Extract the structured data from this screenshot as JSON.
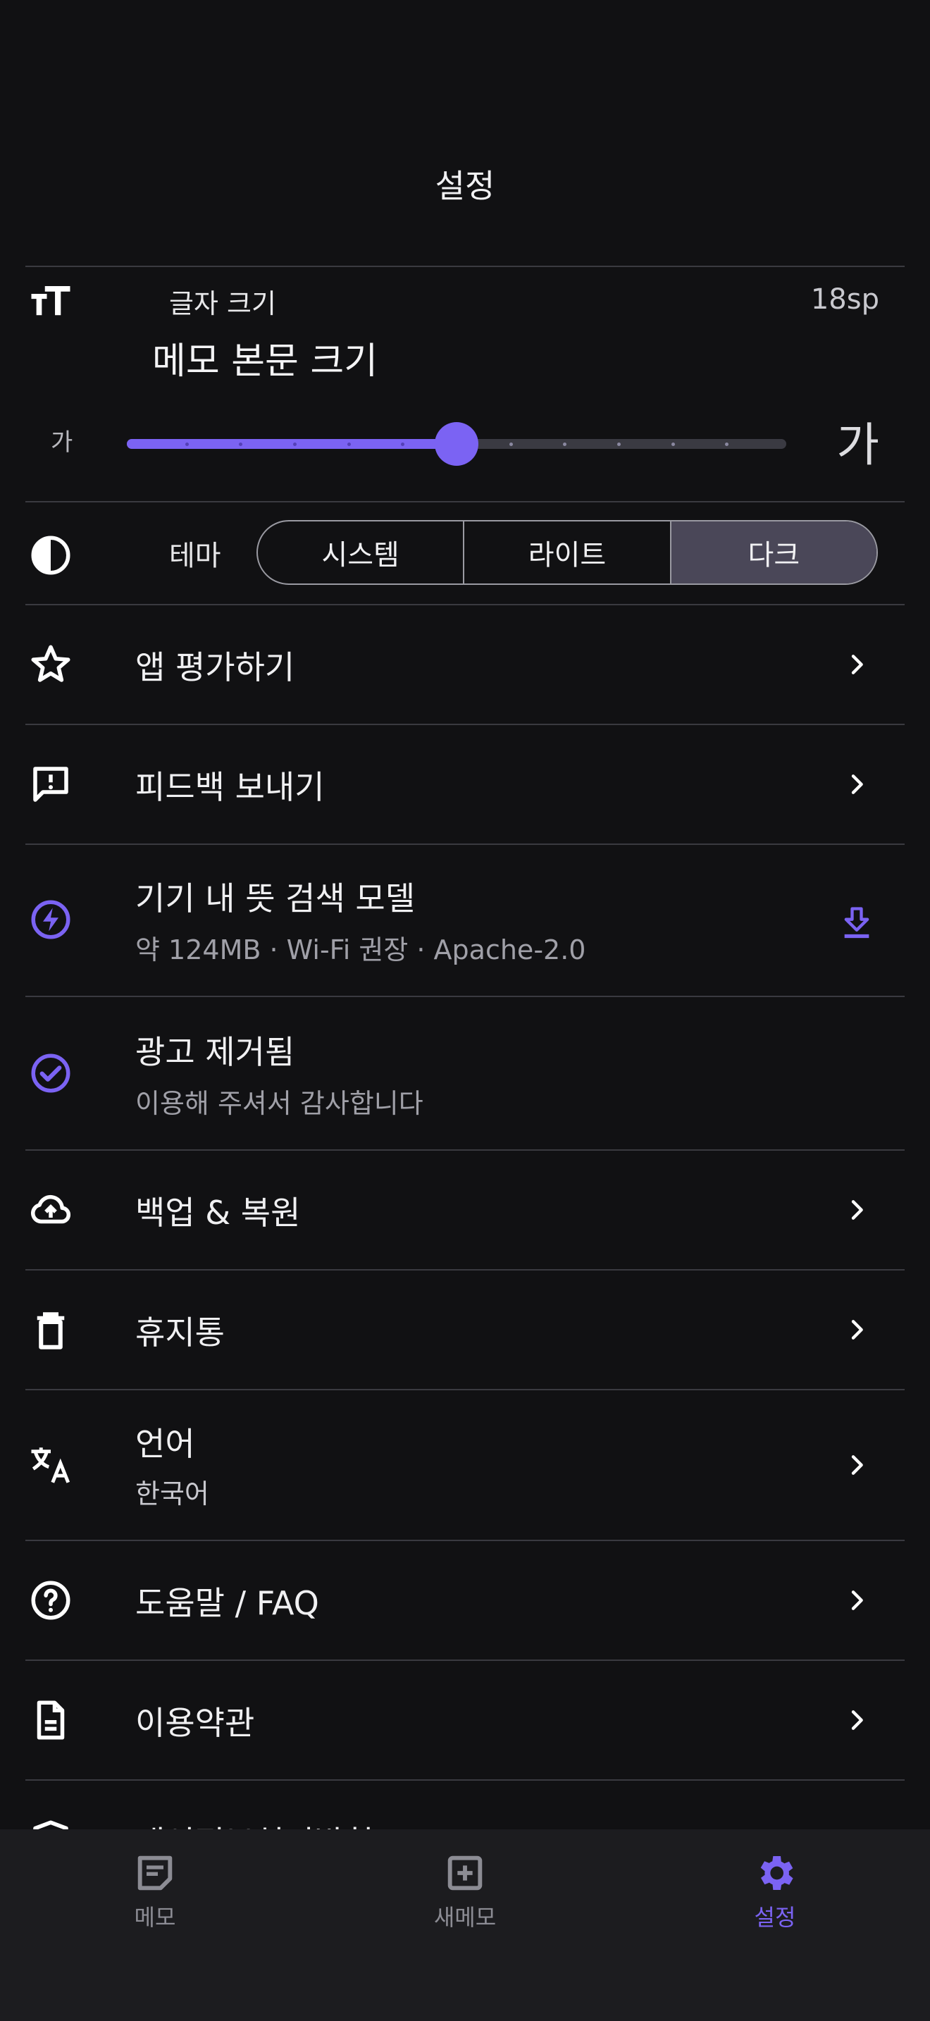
{
  "header": {
    "title": "설정"
  },
  "font_size": {
    "label": "글자 크기",
    "value": "18sp",
    "title": "메모 본문 크기",
    "small_glyph": "가",
    "large_glyph": "가",
    "steps": 12,
    "current_step": 6
  },
  "theme": {
    "label": "테마",
    "options": [
      "시스템",
      "라이트",
      "다크"
    ],
    "selected": "다크"
  },
  "rows": {
    "rate": {
      "title": "앱 평가하기",
      "icon": "star-outline-icon"
    },
    "feedback": {
      "title": "피드백 보내기",
      "icon": "feedback-icon"
    },
    "model": {
      "title": "기기 내 뜻 검색 모델",
      "subtitle": "약 124MB · Wi-Fi 권장 · Apache-2.0",
      "icon": "bolt-circle-icon"
    },
    "ads": {
      "title": "광고 제거됨",
      "subtitle": "이용해 주셔서 감사합니다",
      "icon": "check-circle-icon"
    },
    "backup": {
      "title": "백업 & 복원",
      "icon": "cloud-upload-icon"
    },
    "trash": {
      "title": "휴지통",
      "icon": "trash-icon"
    },
    "language": {
      "title": "언어",
      "subtitle": "한국어",
      "icon": "translate-icon"
    },
    "help": {
      "title": "도움말 / FAQ",
      "icon": "help-circle-icon"
    },
    "terms": {
      "title": "이용약관",
      "icon": "document-icon"
    },
    "privacy": {
      "title": "개인정보처리방침",
      "icon": "shield-icon"
    }
  },
  "bottom_nav": {
    "items": [
      {
        "label": "메모",
        "icon": "memo-icon"
      },
      {
        "label": "새메모",
        "icon": "add-box-icon"
      },
      {
        "label": "설정",
        "icon": "settings-gear-icon"
      }
    ],
    "active": "설정"
  },
  "colors": {
    "accent": "#7B63F3",
    "background": "#111113",
    "nav_background": "#1C1C1F"
  }
}
